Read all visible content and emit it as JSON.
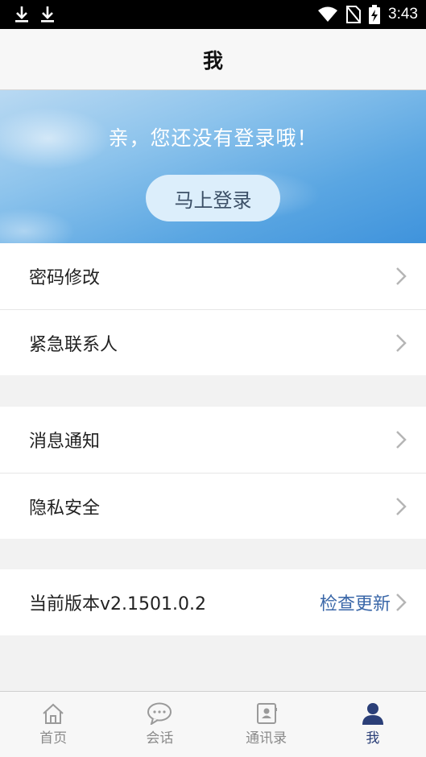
{
  "status_bar": {
    "time": "3:43"
  },
  "header": {
    "title": "我"
  },
  "banner": {
    "message": "亲，您还没有登录哦！",
    "login_button": "马上登录"
  },
  "account_group": {
    "items": [
      {
        "label": "密码修改"
      },
      {
        "label": "紧急联系人"
      }
    ]
  },
  "settings_group": {
    "items": [
      {
        "label": "消息通知"
      },
      {
        "label": "隐私安全"
      }
    ]
  },
  "version_group": {
    "label": "当前版本v2.1501.0.2",
    "action": "检查更新"
  },
  "tabbar": {
    "tabs": [
      {
        "label": "首页",
        "icon": "home-icon"
      },
      {
        "label": "会话",
        "icon": "chat-icon"
      },
      {
        "label": "通讯录",
        "icon": "contacts-icon"
      },
      {
        "label": "我",
        "icon": "person-icon",
        "active": true
      }
    ]
  },
  "colors": {
    "accent": "#2b3f78",
    "link": "#3a67a8",
    "banner_blue": "#5aa6e2"
  }
}
